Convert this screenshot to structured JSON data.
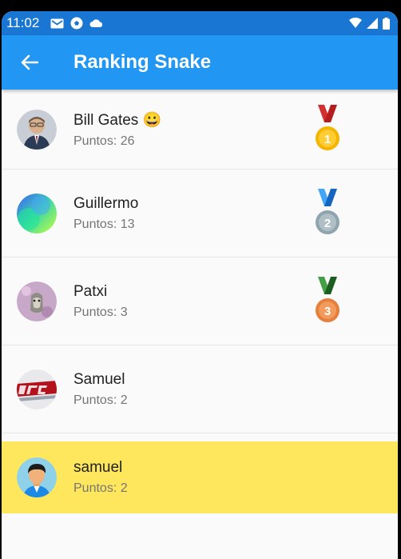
{
  "status": {
    "time": "11:02"
  },
  "appbar": {
    "title": "Ranking Snake"
  },
  "ranking": [
    {
      "name": " Bill Gates 😀",
      "points": "Puntos: 26",
      "medal": "1",
      "medal_ribbon": "#d32f2f",
      "medal_color": "#f5b400"
    },
    {
      "name": "Guillermo",
      "points": "Puntos: 13",
      "medal": "2",
      "medal_ribbon": "#1e88e5",
      "medal_color": "#90a4ae"
    },
    {
      "name": "Patxi",
      "points": "Puntos: 3",
      "medal": "3",
      "medal_ribbon": "#2e7d32",
      "medal_color": "#e67e3c"
    },
    {
      "name": "Samuel",
      "points": "Puntos: 2"
    },
    {
      "name": "samuel",
      "points": "Puntos: 2",
      "highlight_color": "#ffe75d"
    }
  ],
  "colors": {
    "statusbar": "#1976d2",
    "appbar": "#2196f3"
  }
}
